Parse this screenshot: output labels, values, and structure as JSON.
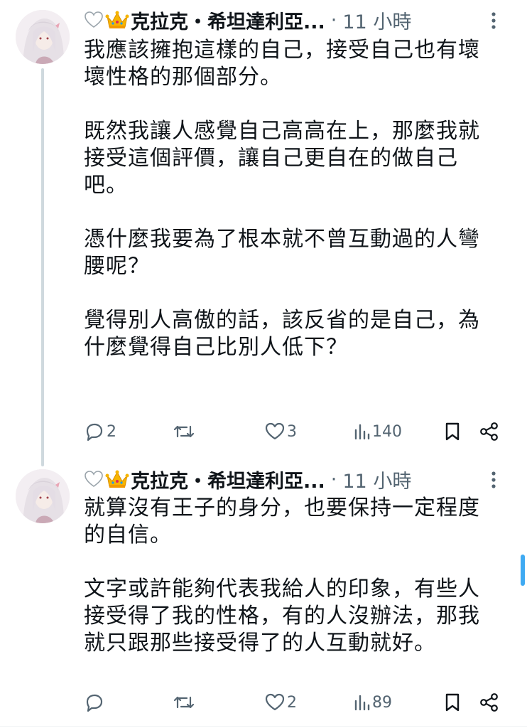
{
  "tweets": [
    {
      "display_name": "克拉克・希坦達利亞...",
      "separator": "·",
      "time": "11 小時",
      "text": "我應該擁抱這樣的自己，接受自己也有壞\n壞性格的那個部分。\n\n既然我讓人感覺自己高高在上，那麼我就\n接受這個評價，讓自己更自在的做自己\n吧。\n\n憑什麼我要為了根本就不曾互動過的人彎\n腰呢？\n\n覺得別人高傲的話，該反省的是自己，為\n什麼覺得自己比別人低下？",
      "replies": "2",
      "retweets": "",
      "likes": "3",
      "views": "140",
      "icons": [
        "white-heart-emoji",
        "crown-emoji",
        "more-icon",
        "reply-icon",
        "retweet-icon",
        "like-icon",
        "views-icon",
        "bookmark-icon",
        "share-icon"
      ]
    },
    {
      "display_name": "克拉克・希坦達利亞...",
      "separator": "·",
      "time": "11 小時",
      "text": "就算沒有王子的身分，也要保持一定程度\n的自信。\n\n文字或許能夠代表我給人的印象，有些人\n接受得了我的性格，有的人沒辦法，那我\n就只跟那些接受得了的人互動就好。",
      "replies": "",
      "retweets": "",
      "likes": "2",
      "views": "89",
      "icons": [
        "white-heart-emoji",
        "crown-emoji",
        "more-icon",
        "reply-icon",
        "retweet-icon",
        "like-icon",
        "views-icon",
        "bookmark-icon",
        "share-icon"
      ]
    }
  ],
  "colors": {
    "text": "#0f1419",
    "secondary": "#536471",
    "thread_line": "#cfd9de",
    "accent": "#1d9bf0"
  }
}
